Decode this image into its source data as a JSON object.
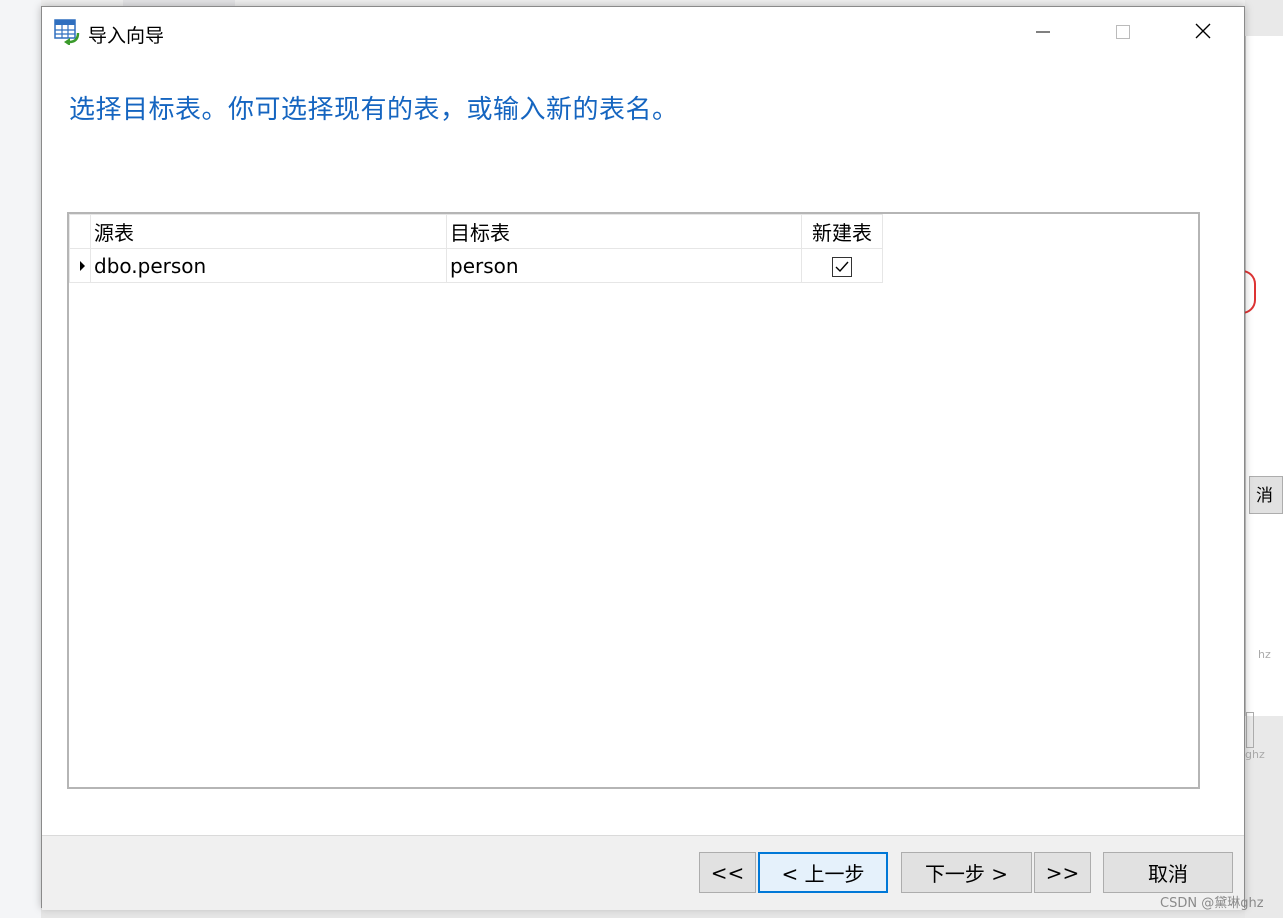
{
  "window": {
    "title": "导入向导",
    "icon": "table-import-icon"
  },
  "controls": {
    "minimize": "minimize-icon",
    "maximize": "maximize-icon",
    "close": "close-icon"
  },
  "instruction": "选择目标表。你可选择现有的表，或输入新的表名。",
  "grid": {
    "columns": [
      "源表",
      "目标表",
      "新建表"
    ],
    "rows": [
      {
        "source": "dbo.person",
        "target": "person",
        "new_table": true
      }
    ]
  },
  "buttons": {
    "first": "<<",
    "prev": "< 上一步",
    "next": "下一步 >",
    "last": ">>",
    "cancel": "取消"
  },
  "background": {
    "right_cancel": "消",
    "right_text1": "hz",
    "right_text2": "ghz"
  },
  "watermark": "CSDN @黛琳ghz",
  "colors": {
    "instruction": "#1565c0",
    "focus_border": "#0078d7"
  }
}
